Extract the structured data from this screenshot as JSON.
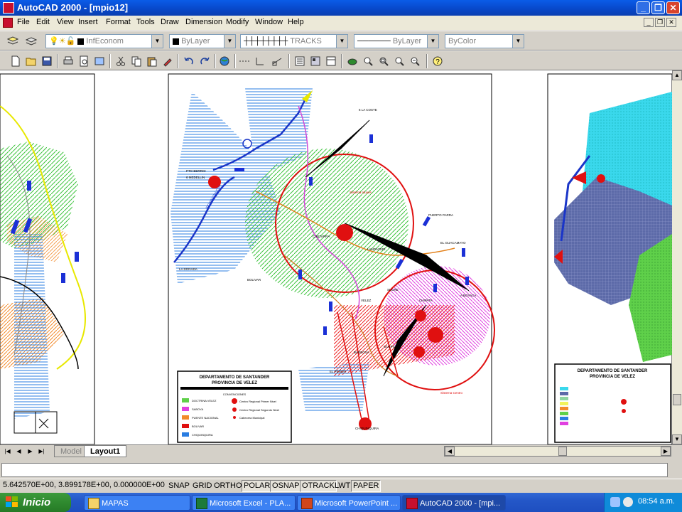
{
  "window": {
    "title": "AutoCAD 2000 - [mpio12]"
  },
  "menu": [
    "File",
    "Edit",
    "View",
    "Insert",
    "Format",
    "Tools",
    "Draw",
    "Dimension",
    "Modify",
    "Window",
    "Help"
  ],
  "properties": {
    "layer": "InfEconom",
    "color": "ByLayer",
    "linetype": "TRACKS",
    "lineweight": "ByLayer",
    "plotstyle": "ByColor"
  },
  "tabs": [
    "Model",
    "Layout1"
  ],
  "status": {
    "coords": "5.642570E+00, 3.899178E+00, 0.000000E+00",
    "buttons": [
      "SNAP",
      "GRID",
      "ORTHO",
      "POLAR",
      "OSNAP",
      "OTRACK",
      "LWT",
      "PAPER"
    ]
  },
  "taskbar": {
    "start": "Inicio",
    "tasks": [
      "MAPAS",
      "Microsoft Excel - PLA...",
      "Microsoft PowerPoint ...",
      "AutoCAD 2000 - [mpi..."
    ],
    "clock": "08:54 a.m."
  },
  "map": {
    "main_title": "DEPARTAMENTO DE SANTANDER",
    "main_subtitle": "PROVINCIA DE VELEZ",
    "right_title": "DEPARTAMENTO DE SANTANDER",
    "right_subtitle": "PROVINCIA DE VELEZ",
    "legend_heading": "CONVENCIONES",
    "legend_left": [
      "DOCTRINA VELEZ",
      "SABOYA",
      "PUENTE NACIONAL",
      "BOLIVAR",
      "CHIQUINQUIRA"
    ],
    "legend_right": [
      "Centro Regional Primer Nivel",
      "Centro Regional Segundo Nivel",
      "Cabecera Municipal"
    ],
    "place_labels": [
      "6 LA COSTE",
      "6 MEDELLIN",
      "PTO BERRIO",
      "LA DORADA",
      "CIMITARRA",
      "LANDAZURI",
      "EL GUACAMAYO",
      "SUCRE",
      "BOLIVAR",
      "PUERTO PARRA",
      "VELEZ",
      "EL PEÑON",
      "BARBOSA",
      "GUEPSA",
      "CHIPATA",
      "CHIQUINQUIRA",
      "A BOYACA",
      "RIO MAGDALENA",
      "Sistema Aluyes",
      "Sistema Centro"
    ]
  }
}
